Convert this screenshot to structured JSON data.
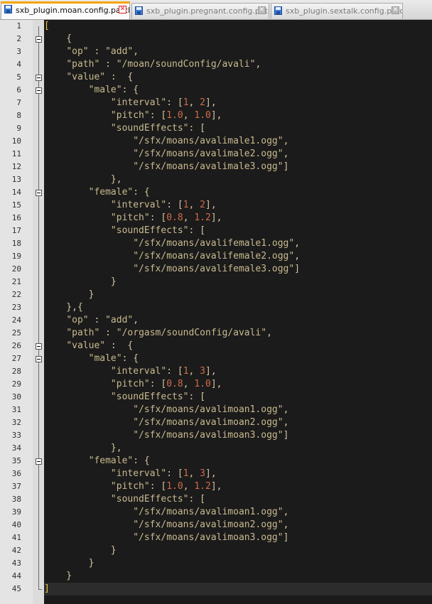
{
  "tabs": [
    {
      "label": "sxb_plugin.moan.config.patch",
      "active": true
    },
    {
      "label": "sxb_plugin.pregnant.config.patch",
      "active": false
    },
    {
      "label": "sxb_plugin.sextalk.config.patch",
      "active": false
    }
  ],
  "fold_lines": [
    2,
    5,
    6,
    14,
    26,
    27,
    35
  ],
  "current_line": 45,
  "code_lines": [
    [
      {
        "t": "[",
        "c": "bk"
      }
    ],
    [
      {
        "t": "    {",
        "c": "p"
      }
    ],
    [
      {
        "t": "    ",
        "c": "p"
      },
      {
        "t": "\"op\"",
        "c": "s"
      },
      {
        "t": " : ",
        "c": "p"
      },
      {
        "t": "\"add\"",
        "c": "s"
      },
      {
        "t": ",",
        "c": "p"
      }
    ],
    [
      {
        "t": "    ",
        "c": "p"
      },
      {
        "t": "\"path\"",
        "c": "s"
      },
      {
        "t": " : ",
        "c": "p"
      },
      {
        "t": "\"/moan/soundConfig/avali\"",
        "c": "s"
      },
      {
        "t": ",",
        "c": "p"
      }
    ],
    [
      {
        "t": "    ",
        "c": "p"
      },
      {
        "t": "\"value\"",
        "c": "s"
      },
      {
        "t": " :  {",
        "c": "p"
      }
    ],
    [
      {
        "t": "        ",
        "c": "p"
      },
      {
        "t": "\"male\"",
        "c": "s"
      },
      {
        "t": ": {",
        "c": "p"
      }
    ],
    [
      {
        "t": "            ",
        "c": "p"
      },
      {
        "t": "\"interval\"",
        "c": "s"
      },
      {
        "t": ": [",
        "c": "p"
      },
      {
        "t": "1",
        "c": "n"
      },
      {
        "t": ", ",
        "c": "p"
      },
      {
        "t": "2",
        "c": "n"
      },
      {
        "t": "],",
        "c": "p"
      }
    ],
    [
      {
        "t": "            ",
        "c": "p"
      },
      {
        "t": "\"pitch\"",
        "c": "s"
      },
      {
        "t": ": [",
        "c": "p"
      },
      {
        "t": "1.0",
        "c": "n"
      },
      {
        "t": ", ",
        "c": "p"
      },
      {
        "t": "1.0",
        "c": "n"
      },
      {
        "t": "],",
        "c": "p"
      }
    ],
    [
      {
        "t": "            ",
        "c": "p"
      },
      {
        "t": "\"soundEffects\"",
        "c": "s"
      },
      {
        "t": ": [",
        "c": "p"
      }
    ],
    [
      {
        "t": "                ",
        "c": "p"
      },
      {
        "t": "\"/sfx/moans/avalimale1.ogg\"",
        "c": "s"
      },
      {
        "t": ",",
        "c": "p"
      }
    ],
    [
      {
        "t": "                ",
        "c": "p"
      },
      {
        "t": "\"/sfx/moans/avalimale2.ogg\"",
        "c": "s"
      },
      {
        "t": ",",
        "c": "p"
      }
    ],
    [
      {
        "t": "                ",
        "c": "p"
      },
      {
        "t": "\"/sfx/moans/avalimale3.ogg\"",
        "c": "s"
      },
      {
        "t": "]",
        "c": "p"
      }
    ],
    [
      {
        "t": "            },",
        "c": "p"
      }
    ],
    [
      {
        "t": "        ",
        "c": "p"
      },
      {
        "t": "\"female\"",
        "c": "s"
      },
      {
        "t": ": {",
        "c": "p"
      }
    ],
    [
      {
        "t": "            ",
        "c": "p"
      },
      {
        "t": "\"interval\"",
        "c": "s"
      },
      {
        "t": ": [",
        "c": "p"
      },
      {
        "t": "1",
        "c": "n"
      },
      {
        "t": ", ",
        "c": "p"
      },
      {
        "t": "2",
        "c": "n"
      },
      {
        "t": "],",
        "c": "p"
      }
    ],
    [
      {
        "t": "            ",
        "c": "p"
      },
      {
        "t": "\"pitch\"",
        "c": "s"
      },
      {
        "t": ": [",
        "c": "p"
      },
      {
        "t": "0.8",
        "c": "n"
      },
      {
        "t": ", ",
        "c": "p"
      },
      {
        "t": "1.2",
        "c": "n"
      },
      {
        "t": "],",
        "c": "p"
      }
    ],
    [
      {
        "t": "            ",
        "c": "p"
      },
      {
        "t": "\"soundEffects\"",
        "c": "s"
      },
      {
        "t": ": [",
        "c": "p"
      }
    ],
    [
      {
        "t": "                ",
        "c": "p"
      },
      {
        "t": "\"/sfx/moans/avalifemale1.ogg\"",
        "c": "s"
      },
      {
        "t": ",",
        "c": "p"
      }
    ],
    [
      {
        "t": "                ",
        "c": "p"
      },
      {
        "t": "\"/sfx/moans/avalifemale2.ogg\"",
        "c": "s"
      },
      {
        "t": ",",
        "c": "p"
      }
    ],
    [
      {
        "t": "                ",
        "c": "p"
      },
      {
        "t": "\"/sfx/moans/avalifemale3.ogg\"",
        "c": "s"
      },
      {
        "t": "]",
        "c": "p"
      }
    ],
    [
      {
        "t": "            }",
        "c": "p"
      }
    ],
    [
      {
        "t": "        }",
        "c": "p"
      }
    ],
    [
      {
        "t": "    },{",
        "c": "p"
      }
    ],
    [
      {
        "t": "    ",
        "c": "p"
      },
      {
        "t": "\"op\"",
        "c": "s"
      },
      {
        "t": " : ",
        "c": "p"
      },
      {
        "t": "\"add\"",
        "c": "s"
      },
      {
        "t": ",",
        "c": "p"
      }
    ],
    [
      {
        "t": "    ",
        "c": "p"
      },
      {
        "t": "\"path\"",
        "c": "s"
      },
      {
        "t": " : ",
        "c": "p"
      },
      {
        "t": "\"/orgasm/soundConfig/avali\"",
        "c": "s"
      },
      {
        "t": ",",
        "c": "p"
      }
    ],
    [
      {
        "t": "    ",
        "c": "p"
      },
      {
        "t": "\"value\"",
        "c": "s"
      },
      {
        "t": " :  {",
        "c": "p"
      }
    ],
    [
      {
        "t": "        ",
        "c": "p"
      },
      {
        "t": "\"male\"",
        "c": "s"
      },
      {
        "t": ": {",
        "c": "p"
      }
    ],
    [
      {
        "t": "            ",
        "c": "p"
      },
      {
        "t": "\"interval\"",
        "c": "s"
      },
      {
        "t": ": [",
        "c": "p"
      },
      {
        "t": "1",
        "c": "n"
      },
      {
        "t": ", ",
        "c": "p"
      },
      {
        "t": "3",
        "c": "n"
      },
      {
        "t": "],",
        "c": "p"
      }
    ],
    [
      {
        "t": "            ",
        "c": "p"
      },
      {
        "t": "\"pitch\"",
        "c": "s"
      },
      {
        "t": ": [",
        "c": "p"
      },
      {
        "t": "0.8",
        "c": "n"
      },
      {
        "t": ", ",
        "c": "p"
      },
      {
        "t": "1.0",
        "c": "n"
      },
      {
        "t": "],",
        "c": "p"
      }
    ],
    [
      {
        "t": "            ",
        "c": "p"
      },
      {
        "t": "\"soundEffects\"",
        "c": "s"
      },
      {
        "t": ": [",
        "c": "p"
      }
    ],
    [
      {
        "t": "                ",
        "c": "p"
      },
      {
        "t": "\"/sfx/moans/avalimoan1.ogg\"",
        "c": "s"
      },
      {
        "t": ",",
        "c": "p"
      }
    ],
    [
      {
        "t": "                ",
        "c": "p"
      },
      {
        "t": "\"/sfx/moans/avalimoan2.ogg\"",
        "c": "s"
      },
      {
        "t": ",",
        "c": "p"
      }
    ],
    [
      {
        "t": "                ",
        "c": "p"
      },
      {
        "t": "\"/sfx/moans/avalimoan3.ogg\"",
        "c": "s"
      },
      {
        "t": "]",
        "c": "p"
      }
    ],
    [
      {
        "t": "            },",
        "c": "p"
      }
    ],
    [
      {
        "t": "        ",
        "c": "p"
      },
      {
        "t": "\"female\"",
        "c": "s"
      },
      {
        "t": ": {",
        "c": "p"
      }
    ],
    [
      {
        "t": "            ",
        "c": "p"
      },
      {
        "t": "\"interval\"",
        "c": "s"
      },
      {
        "t": ": [",
        "c": "p"
      },
      {
        "t": "1",
        "c": "n"
      },
      {
        "t": ", ",
        "c": "p"
      },
      {
        "t": "3",
        "c": "n"
      },
      {
        "t": "],",
        "c": "p"
      }
    ],
    [
      {
        "t": "            ",
        "c": "p"
      },
      {
        "t": "\"pitch\"",
        "c": "s"
      },
      {
        "t": ": [",
        "c": "p"
      },
      {
        "t": "1.0",
        "c": "n"
      },
      {
        "t": ", ",
        "c": "p"
      },
      {
        "t": "1.2",
        "c": "n"
      },
      {
        "t": "],",
        "c": "p"
      }
    ],
    [
      {
        "t": "            ",
        "c": "p"
      },
      {
        "t": "\"soundEffects\"",
        "c": "s"
      },
      {
        "t": ": [",
        "c": "p"
      }
    ],
    [
      {
        "t": "                ",
        "c": "p"
      },
      {
        "t": "\"/sfx/moans/avalimoan1.ogg\"",
        "c": "s"
      },
      {
        "t": ",",
        "c": "p"
      }
    ],
    [
      {
        "t": "                ",
        "c": "p"
      },
      {
        "t": "\"/sfx/moans/avalimoan2.ogg\"",
        "c": "s"
      },
      {
        "t": ",",
        "c": "p"
      }
    ],
    [
      {
        "t": "                ",
        "c": "p"
      },
      {
        "t": "\"/sfx/moans/avalimoan3.ogg\"",
        "c": "s"
      },
      {
        "t": "]",
        "c": "p"
      }
    ],
    [
      {
        "t": "            }",
        "c": "p"
      }
    ],
    [
      {
        "t": "        }",
        "c": "p"
      }
    ],
    [
      {
        "t": "    }",
        "c": "p"
      }
    ],
    [
      {
        "t": "]",
        "c": "bk"
      }
    ]
  ]
}
